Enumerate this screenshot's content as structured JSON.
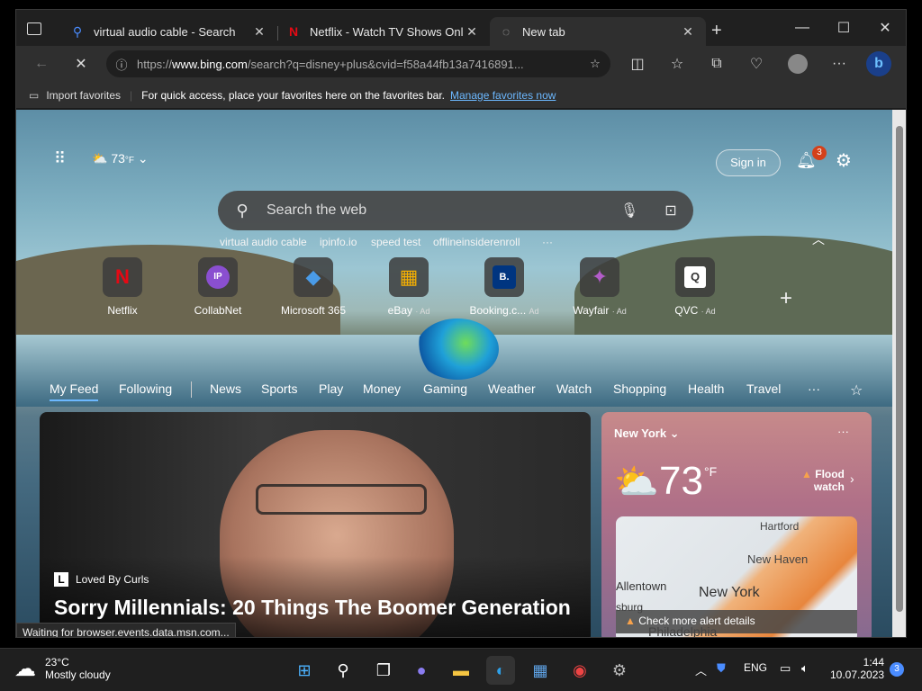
{
  "tabs": [
    {
      "title": "virtual audio cable - Search",
      "close": "✕"
    },
    {
      "title": "Netflix - Watch TV Shows Online",
      "close": "✕"
    },
    {
      "title": "New tab",
      "close": "✕"
    }
  ],
  "new_tab": "+",
  "window_controls": {
    "minimize": "—",
    "maximize": "☐",
    "close": "✕"
  },
  "address": {
    "url_prefix": "https://",
    "url_host": "www.bing.com",
    "url_rest": "/search?q=disney+plus&cvid=f58a44fb13a7416891..."
  },
  "favorites_bar": {
    "import": "Import favorites",
    "hint": "For quick access, place your favorites here on the favorites bar.",
    "manage": "Manage favorites now"
  },
  "ntp": {
    "weather_temp": "73",
    "weather_unit": "°F",
    "sign_in": "Sign in",
    "notif_count": "3",
    "search_placeholder": "Search the web",
    "suggestions": [
      "virtual audio cable",
      "ipinfo.io",
      "speed test",
      "offlineinsiderenroll"
    ],
    "more": "···",
    "quick_links": [
      {
        "label": "Netflix",
        "ad": "",
        "glyph": "N",
        "color": "#e50914"
      },
      {
        "label": "CollabNet",
        "ad": "",
        "glyph": "IP",
        "color": "#8a4fd0"
      },
      {
        "label": "Microsoft 365",
        "ad": "",
        "glyph": "◆",
        "color": "#4a9be8"
      },
      {
        "label": "eBay",
        "ad": "· Ad",
        "glyph": "▦",
        "color": "#f5af02"
      },
      {
        "label": "Booking.c...",
        "ad": "Ad",
        "glyph": "B.",
        "color": "#003580"
      },
      {
        "label": "Wayfair",
        "ad": "· Ad",
        "glyph": "✦",
        "color": "#7f187f"
      },
      {
        "label": "QVC",
        "ad": "· Ad",
        "glyph": "Q",
        "color": "#333"
      }
    ],
    "add": "+",
    "nav": [
      "My Feed",
      "Following",
      "News",
      "Sports",
      "Play",
      "Money",
      "Gaming",
      "Weather",
      "Watch",
      "Shopping",
      "Health",
      "Travel"
    ],
    "nav_more": "···",
    "article": {
      "source": "Loved By Curls",
      "source_logo": "L",
      "headline": "Sorry Millennials: 20 Things The Boomer Generation"
    },
    "weather_card": {
      "city": "New York",
      "temp": "73",
      "unit": "°F",
      "alert": "Flood",
      "alert2": "watch",
      "map_labels": [
        "Hartford",
        "New Haven",
        "Allentown",
        "New York",
        "sburg",
        "Philadelphia"
      ],
      "check": "Check more alert details"
    }
  },
  "status": "Waiting for browser.events.data.msn.com...",
  "taskbar": {
    "weather_temp": "23°C",
    "weather_desc": "Mostly cloudy",
    "lang": "ENG",
    "time": "1:44",
    "date": "10.07.2023",
    "notif": "3"
  },
  "colors": {
    "accent": "#0078d4",
    "link": "#6cb8ff"
  }
}
